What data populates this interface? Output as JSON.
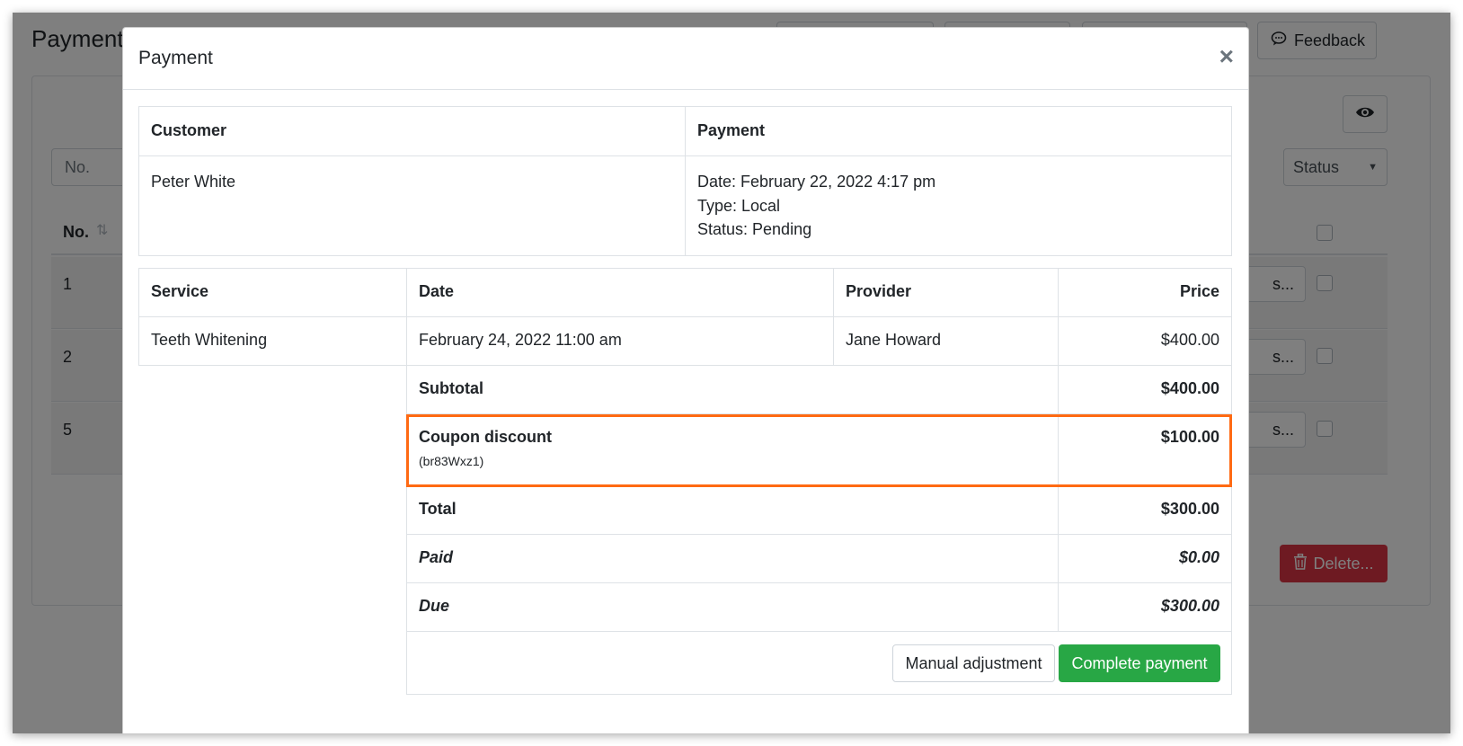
{
  "background": {
    "page_title": "Payments",
    "feedback_label": "Feedback",
    "search_placeholder": "No.",
    "status_select": "Status",
    "column_no": "No.",
    "rows": [
      {
        "num": "1",
        "button": "s..."
      },
      {
        "num": "2",
        "button": "s..."
      },
      {
        "num": "5",
        "button": "s..."
      }
    ],
    "delete_label": "Delete..."
  },
  "modal": {
    "title": "Payment",
    "close": "×",
    "info": {
      "customer_header": "Customer",
      "payment_header": "Payment",
      "customer_name": "Peter White",
      "date_line": "Date: February 22, 2022 4:17 pm",
      "type_line": "Type: Local",
      "status_line": "Status: Pending"
    },
    "services": {
      "headers": {
        "service": "Service",
        "date": "Date",
        "provider": "Provider",
        "price": "Price"
      },
      "rows": [
        {
          "service": "Teeth Whitening",
          "date": "February 24, 2022 11:00 am",
          "provider": "Jane Howard",
          "price": "$400.00"
        }
      ]
    },
    "summary": {
      "subtotal_label": "Subtotal",
      "subtotal_value": "$400.00",
      "coupon_label": "Coupon discount",
      "coupon_code": "(br83Wxz1)",
      "coupon_value": "$100.00",
      "total_label": "Total",
      "total_value": "$300.00",
      "paid_label": "Paid",
      "paid_value": "$0.00",
      "due_label": "Due",
      "due_value": "$300.00"
    },
    "actions": {
      "manual_label": "Manual adjustment",
      "complete_label": "Complete payment"
    }
  },
  "colors": {
    "highlight": "#ff6a13",
    "complete": "#28a745",
    "delete": "#dc3545"
  }
}
